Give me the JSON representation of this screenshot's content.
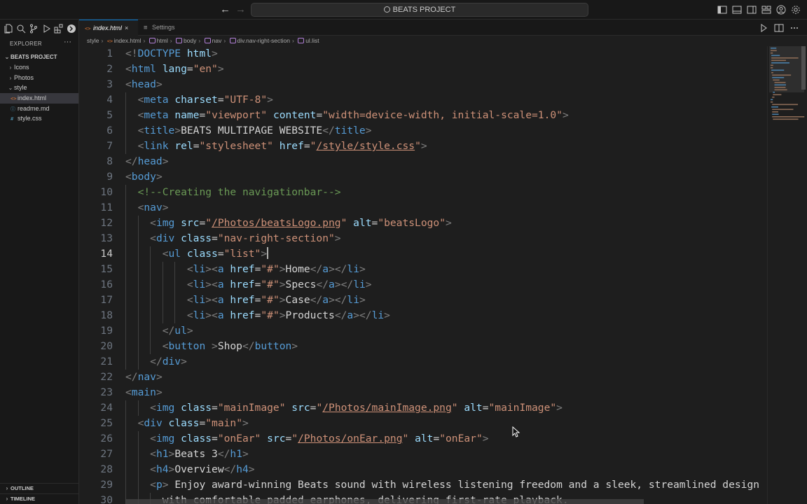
{
  "window": {
    "title": "BEATS PROJECT"
  },
  "sidebar": {
    "header": "EXPLORER",
    "more": "···",
    "project": "BEATS PROJECT",
    "tree": [
      {
        "label": "Icons",
        "kind": "folder",
        "expanded": false,
        "depth": 1
      },
      {
        "label": "Photos",
        "kind": "folder",
        "expanded": false,
        "depth": 1
      },
      {
        "label": "style",
        "kind": "folder",
        "expanded": true,
        "depth": 1
      },
      {
        "label": "index.html",
        "kind": "html",
        "selected": true,
        "depth": 2
      },
      {
        "label": "readme.md",
        "kind": "md",
        "depth": 2
      },
      {
        "label": "style.css",
        "kind": "css",
        "depth": 2
      }
    ],
    "outline": "OUTLINE",
    "timeline": "TIMELINE"
  },
  "tabs": [
    {
      "label": "index.html",
      "active": true,
      "close": "×"
    },
    {
      "label": "Settings",
      "active": false
    }
  ],
  "breadcrumb": [
    "style",
    "index.html",
    "html",
    "body",
    "nav",
    "div.nav-right-section",
    "ul.list"
  ],
  "editor": {
    "active_line": 14,
    "lines": [
      [
        [
          "br",
          "<!"
        ],
        [
          "tag",
          "DOCTYPE"
        ],
        [
          "txt",
          " "
        ],
        [
          "attr",
          "html"
        ],
        [
          "br",
          ">"
        ]
      ],
      [
        [
          "br",
          "<"
        ],
        [
          "tag",
          "html"
        ],
        [
          "txt",
          " "
        ],
        [
          "attr",
          "lang"
        ],
        [
          "txt",
          "="
        ],
        [
          "str",
          "\"en\""
        ],
        [
          "br",
          ">"
        ]
      ],
      [
        [
          "br",
          "<"
        ],
        [
          "tag",
          "head"
        ],
        [
          "br",
          ">"
        ]
      ],
      [
        [
          "txt",
          "  "
        ],
        [
          "br",
          "<"
        ],
        [
          "tag",
          "meta"
        ],
        [
          "txt",
          " "
        ],
        [
          "attr",
          "charset"
        ],
        [
          "txt",
          "="
        ],
        [
          "str",
          "\"UTF-8\""
        ],
        [
          "br",
          ">"
        ]
      ],
      [
        [
          "txt",
          "  "
        ],
        [
          "br",
          "<"
        ],
        [
          "tag",
          "meta"
        ],
        [
          "txt",
          " "
        ],
        [
          "attr",
          "name"
        ],
        [
          "txt",
          "="
        ],
        [
          "str",
          "\"viewport\""
        ],
        [
          "txt",
          " "
        ],
        [
          "attr",
          "content"
        ],
        [
          "txt",
          "="
        ],
        [
          "str",
          "\"width=device-width, initial-scale=1.0\""
        ],
        [
          "br",
          ">"
        ]
      ],
      [
        [
          "txt",
          "  "
        ],
        [
          "br",
          "<"
        ],
        [
          "tag",
          "title"
        ],
        [
          "br",
          ">"
        ],
        [
          "txt",
          "BEATS MULTIPAGE WEBSITE"
        ],
        [
          "br",
          "</"
        ],
        [
          "tag",
          "title"
        ],
        [
          "br",
          ">"
        ]
      ],
      [
        [
          "txt",
          "  "
        ],
        [
          "br",
          "<"
        ],
        [
          "tag",
          "link"
        ],
        [
          "txt",
          " "
        ],
        [
          "attr",
          "rel"
        ],
        [
          "txt",
          "="
        ],
        [
          "str",
          "\"stylesheet\""
        ],
        [
          "txt",
          " "
        ],
        [
          "attr",
          "href"
        ],
        [
          "txt",
          "="
        ],
        [
          "str",
          "\""
        ],
        [
          "link",
          "/style/style.css"
        ],
        [
          "str",
          "\""
        ],
        [
          "br",
          ">"
        ]
      ],
      [
        [
          "br",
          "</"
        ],
        [
          "tag",
          "head"
        ],
        [
          "br",
          ">"
        ]
      ],
      [
        [
          "br",
          "<"
        ],
        [
          "tag",
          "body"
        ],
        [
          "br",
          ">"
        ]
      ],
      [
        [
          "txt",
          "  "
        ],
        [
          "cmt",
          "<!--Creating the navigationbar-->"
        ]
      ],
      [
        [
          "txt",
          "  "
        ],
        [
          "br",
          "<"
        ],
        [
          "tag",
          "nav"
        ],
        [
          "br",
          ">"
        ]
      ],
      [
        [
          "txt",
          "    "
        ],
        [
          "br",
          "<"
        ],
        [
          "tag",
          "img"
        ],
        [
          "txt",
          " "
        ],
        [
          "attr",
          "src"
        ],
        [
          "txt",
          "="
        ],
        [
          "str",
          "\""
        ],
        [
          "link",
          "/Photos/beatsLogo.png"
        ],
        [
          "str",
          "\""
        ],
        [
          "txt",
          " "
        ],
        [
          "attr",
          "alt"
        ],
        [
          "txt",
          "="
        ],
        [
          "str",
          "\"beatsLogo\""
        ],
        [
          "br",
          ">"
        ]
      ],
      [
        [
          "txt",
          "    "
        ],
        [
          "br",
          "<"
        ],
        [
          "tag",
          "div"
        ],
        [
          "txt",
          " "
        ],
        [
          "attr",
          "class"
        ],
        [
          "txt",
          "="
        ],
        [
          "str",
          "\"nav-right-section\""
        ],
        [
          "br",
          ">"
        ]
      ],
      [
        [
          "txt",
          "      "
        ],
        [
          "br",
          "<"
        ],
        [
          "tag",
          "ul"
        ],
        [
          "txt",
          " "
        ],
        [
          "attr",
          "class"
        ],
        [
          "txt",
          "="
        ],
        [
          "str",
          "\"list\""
        ],
        [
          "br",
          ">"
        ],
        [
          "cursor",
          ""
        ]
      ],
      [
        [
          "txt",
          "          "
        ],
        [
          "br",
          "<"
        ],
        [
          "tag",
          "li"
        ],
        [
          "br",
          "><"
        ],
        [
          "tag",
          "a"
        ],
        [
          "txt",
          " "
        ],
        [
          "attr",
          "href"
        ],
        [
          "txt",
          "="
        ],
        [
          "str",
          "\"#\""
        ],
        [
          "br",
          ">"
        ],
        [
          "txt",
          "Home"
        ],
        [
          "br",
          "</"
        ],
        [
          "tag",
          "a"
        ],
        [
          "br",
          "></"
        ],
        [
          "tag",
          "li"
        ],
        [
          "br",
          ">"
        ]
      ],
      [
        [
          "txt",
          "          "
        ],
        [
          "br",
          "<"
        ],
        [
          "tag",
          "li"
        ],
        [
          "br",
          "><"
        ],
        [
          "tag",
          "a"
        ],
        [
          "txt",
          " "
        ],
        [
          "attr",
          "href"
        ],
        [
          "txt",
          "="
        ],
        [
          "str",
          "\"#\""
        ],
        [
          "br",
          ">"
        ],
        [
          "txt",
          "Specs"
        ],
        [
          "br",
          "</"
        ],
        [
          "tag",
          "a"
        ],
        [
          "br",
          "></"
        ],
        [
          "tag",
          "li"
        ],
        [
          "br",
          ">"
        ]
      ],
      [
        [
          "txt",
          "          "
        ],
        [
          "br",
          "<"
        ],
        [
          "tag",
          "li"
        ],
        [
          "br",
          "><"
        ],
        [
          "tag",
          "a"
        ],
        [
          "txt",
          " "
        ],
        [
          "attr",
          "href"
        ],
        [
          "txt",
          "="
        ],
        [
          "str",
          "\"#\""
        ],
        [
          "br",
          ">"
        ],
        [
          "txt",
          "Case"
        ],
        [
          "br",
          "</"
        ],
        [
          "tag",
          "a"
        ],
        [
          "br",
          "></"
        ],
        [
          "tag",
          "li"
        ],
        [
          "br",
          ">"
        ]
      ],
      [
        [
          "txt",
          "          "
        ],
        [
          "br",
          "<"
        ],
        [
          "tag",
          "li"
        ],
        [
          "br",
          "><"
        ],
        [
          "tag",
          "a"
        ],
        [
          "txt",
          " "
        ],
        [
          "attr",
          "href"
        ],
        [
          "txt",
          "="
        ],
        [
          "str",
          "\"#\""
        ],
        [
          "br",
          ">"
        ],
        [
          "txt",
          "Products"
        ],
        [
          "br",
          "</"
        ],
        [
          "tag",
          "a"
        ],
        [
          "br",
          "></"
        ],
        [
          "tag",
          "li"
        ],
        [
          "br",
          ">"
        ]
      ],
      [
        [
          "txt",
          "      "
        ],
        [
          "br",
          "</"
        ],
        [
          "tag",
          "ul"
        ],
        [
          "br",
          ">"
        ]
      ],
      [
        [
          "txt",
          "      "
        ],
        [
          "br",
          "<"
        ],
        [
          "tag",
          "button"
        ],
        [
          "txt",
          " "
        ],
        [
          "br",
          ">"
        ],
        [
          "txt",
          "Shop"
        ],
        [
          "br",
          "</"
        ],
        [
          "tag",
          "button"
        ],
        [
          "br",
          ">"
        ]
      ],
      [
        [
          "txt",
          "    "
        ],
        [
          "br",
          "</"
        ],
        [
          "tag",
          "div"
        ],
        [
          "br",
          ">"
        ]
      ],
      [
        [
          "br",
          "</"
        ],
        [
          "tag",
          "nav"
        ],
        [
          "br",
          ">"
        ]
      ],
      [
        [
          "br",
          "<"
        ],
        [
          "tag",
          "main"
        ],
        [
          "br",
          ">"
        ]
      ],
      [
        [
          "txt",
          "    "
        ],
        [
          "br",
          "<"
        ],
        [
          "tag",
          "img"
        ],
        [
          "txt",
          " "
        ],
        [
          "attr",
          "class"
        ],
        [
          "txt",
          "="
        ],
        [
          "str",
          "\"mainImage\""
        ],
        [
          "txt",
          " "
        ],
        [
          "attr",
          "src"
        ],
        [
          "txt",
          "="
        ],
        [
          "str",
          "\""
        ],
        [
          "link",
          "/Photos/mainImage.png"
        ],
        [
          "str",
          "\""
        ],
        [
          "txt",
          " "
        ],
        [
          "attr",
          "alt"
        ],
        [
          "txt",
          "="
        ],
        [
          "str",
          "\"mainImage\""
        ],
        [
          "br",
          ">"
        ]
      ],
      [
        [
          "txt",
          "  "
        ],
        [
          "br",
          "<"
        ],
        [
          "tag",
          "div"
        ],
        [
          "txt",
          " "
        ],
        [
          "attr",
          "class"
        ],
        [
          "txt",
          "="
        ],
        [
          "str",
          "\"main\""
        ],
        [
          "br",
          ">"
        ]
      ],
      [
        [
          "txt",
          "    "
        ],
        [
          "br",
          "<"
        ],
        [
          "tag",
          "img"
        ],
        [
          "txt",
          " "
        ],
        [
          "attr",
          "class"
        ],
        [
          "txt",
          "="
        ],
        [
          "str",
          "\"onEar\""
        ],
        [
          "txt",
          " "
        ],
        [
          "attr",
          "src"
        ],
        [
          "txt",
          "="
        ],
        [
          "str",
          "\""
        ],
        [
          "link",
          "/Photos/onEar.png"
        ],
        [
          "str",
          "\""
        ],
        [
          "txt",
          " "
        ],
        [
          "attr",
          "alt"
        ],
        [
          "txt",
          "="
        ],
        [
          "str",
          "\"onEar\""
        ],
        [
          "br",
          ">"
        ]
      ],
      [
        [
          "txt",
          "    "
        ],
        [
          "br",
          "<"
        ],
        [
          "tag",
          "h1"
        ],
        [
          "br",
          ">"
        ],
        [
          "txt",
          "Beats 3"
        ],
        [
          "br",
          "</"
        ],
        [
          "tag",
          "h1"
        ],
        [
          "br",
          ">"
        ]
      ],
      [
        [
          "txt",
          "    "
        ],
        [
          "br",
          "<"
        ],
        [
          "tag",
          "h4"
        ],
        [
          "br",
          ">"
        ],
        [
          "txt",
          "Overview"
        ],
        [
          "br",
          "</"
        ],
        [
          "tag",
          "h4"
        ],
        [
          "br",
          ">"
        ]
      ],
      [
        [
          "txt",
          "    "
        ],
        [
          "br",
          "<"
        ],
        [
          "tag",
          "p"
        ],
        [
          "br",
          ">"
        ],
        [
          "txt",
          " Enjoy award-winning Beats sound with wireless listening freedom and a sleek, streamlined design"
        ]
      ],
      [
        [
          "txt",
          "      with comfortable padded earphones, delivering first-rate playback."
        ]
      ]
    ]
  }
}
